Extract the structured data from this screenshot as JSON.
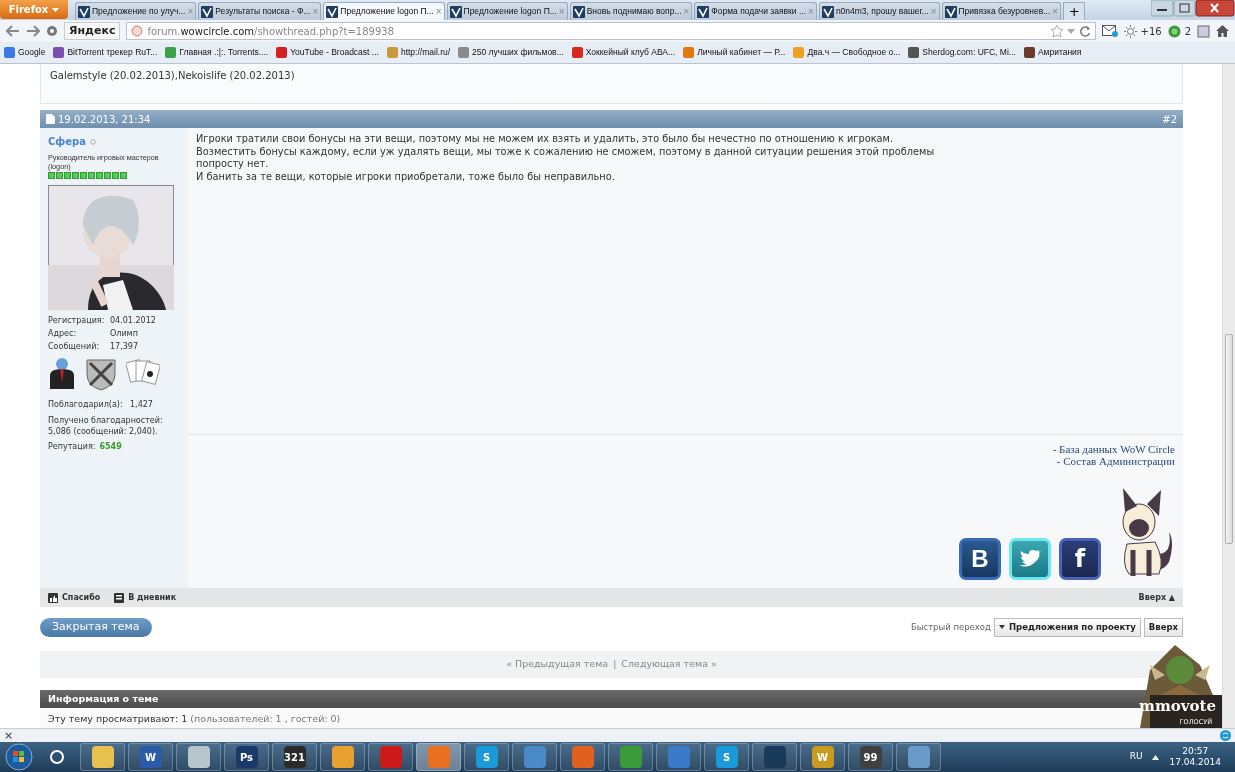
{
  "browser": {
    "menu_button": "Firefox",
    "tabs": [
      {
        "title": "Предложение по улуч...",
        "selected": false,
        "close": "×"
      },
      {
        "title": "Результаты поиска - Ф...",
        "selected": false,
        "close": "×"
      },
      {
        "title": "Предложение logon П...",
        "selected": true,
        "close": "×"
      },
      {
        "title": "Предложение logon П...",
        "selected": false,
        "close": "×"
      },
      {
        "title": "Вновь поднимаю вопр...",
        "selected": false,
        "close": "×"
      },
      {
        "title": "Форма подачи заявки ...",
        "selected": false,
        "close": "×"
      },
      {
        "title": "n0n4m3, прошу вашег...",
        "selected": false,
        "close": "×"
      },
      {
        "title": "Привязка безуровнев...",
        "selected": false,
        "close": "×"
      }
    ],
    "new_tab": "+",
    "search_engine": "Яндекс",
    "url": "forum.**wowcircle.com**/showthread.php?t=189938",
    "extensions": [
      {
        "kind": "mail"
      },
      {
        "kind": "weather",
        "label": "+16"
      },
      {
        "kind": "counter",
        "label": "2"
      },
      {
        "kind": "addon"
      }
    ],
    "bookmarks": [
      {
        "label": "Google",
        "color": "#3b78e7"
      },
      {
        "label": "BitTorrent трекер RuT...",
        "color": "#7a4fb0"
      },
      {
        "label": "Главная .:|:. Torrents....",
        "color": "#3aa04a"
      },
      {
        "label": "YouTube - Broadcast ...",
        "color": "#d42020"
      },
      {
        "label": "http://mail.ru/",
        "color": "#c89a3a"
      },
      {
        "label": "250 лучших фильмов...",
        "color": "#8a8a8a"
      },
      {
        "label": "Хоккейный клуб АВА...",
        "color": "#d8281e"
      },
      {
        "label": "Личный кабинет — Р...",
        "color": "#e07a10"
      },
      {
        "label": "Два.ч — Свободное о...",
        "color": "#f0a020"
      },
      {
        "label": "Sherdog.com: UFC, Mi...",
        "color": "#555555"
      },
      {
        "label": "Амритания",
        "color": "#6a3a2a"
      }
    ]
  },
  "previous_thanks": [
    {
      "name": "Galemstyle",
      "date": "(20.02.2013),"
    },
    {
      "name": "Nekoislife",
      "date": "(20.02.2013)"
    }
  ],
  "post": {
    "date": "19.02.2013, 21:34",
    "number": "#2",
    "author": {
      "name": "Сфера",
      "online": false,
      "title": "Руководитель игровых мастеров (logon)",
      "stars": 10,
      "stats": [
        {
          "label": "Регистрация:",
          "value": "04.01.2012"
        },
        {
          "label": "Адрес:",
          "value": "Олимп"
        },
        {
          "label": "Сообщений:",
          "value": "17,397"
        }
      ],
      "thanked": {
        "label": "Поблагодарил(а):",
        "value": "1,427"
      },
      "thanks_received": "Получено благодарностей: 5,086 (сообщений: 2,040).",
      "reputation": {
        "label": "Репутация:",
        "value": "6549"
      }
    },
    "lines": [
      "Игроки тратили свои бонусы на эти вещи, поэтому мы не можем их взять и удалить, это было бы нечестно по отношению к игрокам.",
      "Возместить бонусы каждому, если уж удалять вещи, мы тоже к сожалению не сможем, поэтому в данной ситуации решения этой проблемы",
      "попросту нет.",
      "И банить за те вещи, которые игроки приобретали, тоже было бы неправильно."
    ],
    "signature_links": [
      "- База данных WoW Circle",
      "- Состав Администрации"
    ],
    "social": [
      {
        "kind": "vk",
        "label": "B"
      },
      {
        "kind": "twitter"
      },
      {
        "kind": "facebook",
        "label": "f"
      }
    ],
    "actions": [
      {
        "kind": "thanks",
        "label": "Спасибо"
      },
      {
        "kind": "diary",
        "label": "В дневник"
      }
    ],
    "top_link": "Вверх ▲"
  },
  "thread": {
    "status_button": "Закрытая тема",
    "quick_nav_label": "Быстрый переход",
    "quick_nav_value": "Предложения по проекту",
    "go_button": "Вверх",
    "prev": "« Предыдущая тема",
    "separator": "|",
    "next": "Следующая тема »",
    "info_title": "Информация о теме",
    "viewers": "Эту тему просматривают: 1",
    "viewers_detail": "(пользователей: 1 , гостей: 0)"
  },
  "banner": {
    "title": "mmovote",
    "subtitle": "ГОЛОСУЙ"
  },
  "notification_close": "×",
  "taskbar": {
    "apps": [
      {
        "color": "#e8c050",
        "selected": false
      },
      {
        "color": "#2a5aa8",
        "label": "W",
        "selected": false
      },
      {
        "color": "#b8c4cc",
        "selected": false
      },
      {
        "color": "#1a3a6a",
        "label": "Ps",
        "selected": false
      },
      {
        "color": "#2a2a2a",
        "label": "321",
        "selected": false
      },
      {
        "color": "#e8a030",
        "selected": false
      },
      {
        "color": "#cc1a1a",
        "selected": false
      },
      {
        "color": "#e87020",
        "selected": true
      },
      {
        "color": "#1a9ad8",
        "label": "S",
        "selected": false
      },
      {
        "color": "#4a8ac8",
        "selected": false
      },
      {
        "color": "#e06020",
        "selected": false
      },
      {
        "color": "#3a9a3a",
        "selected": false
      },
      {
        "color": "#3a7ac8",
        "selected": false
      },
      {
        "color": "#1a9ad8",
        "label": "S",
        "selected": false
      },
      {
        "color": "#1a3a5a",
        "selected": false
      },
      {
        "color": "#c89a20",
        "label": "W",
        "selected": false
      },
      {
        "color": "#404040",
        "label": "99",
        "selected": false
      },
      {
        "color": "#6a9ac8",
        "selected": false
      }
    ],
    "language": "RU",
    "time": "20:57",
    "date": "17.04.2014"
  }
}
